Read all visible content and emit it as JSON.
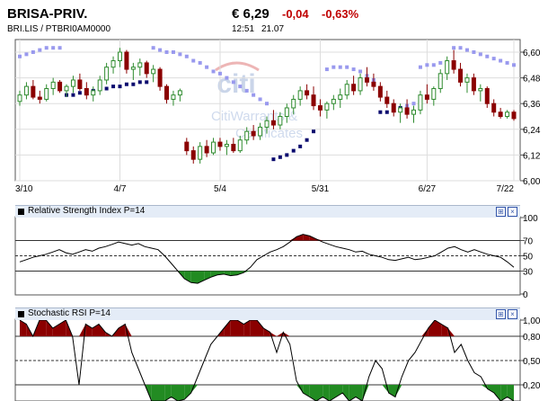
{
  "header": {
    "title": "BRISA-PRIV.",
    "subtitle": "BRI.LIS  /  PTBRI0AM0000",
    "price": "€ 6,29",
    "change": "-0,04",
    "change_pct": "-0,63%",
    "time": "12:51",
    "date": "21.07"
  },
  "watermark": {
    "logo": "citi",
    "line1": "CitiWarrants &",
    "line2": "Certificates"
  },
  "panels": {
    "rsi": {
      "label": "Relative Strength Index P=14",
      "ticks": [
        "100",
        "70",
        "50",
        "30",
        "0"
      ]
    },
    "stoch": {
      "label": "Stochastic RSI P=14",
      "ticks": [
        "1,00",
        "0,80",
        "0,50",
        "0,20"
      ]
    }
  },
  "chart_data": [
    {
      "type": "candlestick",
      "x_ticks": [
        "3/10",
        "4/7",
        "5/4",
        "5/31",
        "6/27",
        "7/22"
      ],
      "y_ticks": [
        "6,60",
        "6,48",
        "6,36",
        "6,24",
        "6,12",
        "6,00"
      ],
      "ylim": [
        6.0,
        6.6
      ],
      "colors": {
        "up": "#2e8b2e",
        "down": "#8b0000",
        "sar": "#9999ee",
        "sar_dark": "#0a0a6e"
      },
      "ohlc": [
        [
          6.37,
          6.42,
          6.35,
          6.4
        ],
        [
          6.4,
          6.46,
          6.38,
          6.44
        ],
        [
          6.44,
          6.47,
          6.38,
          6.39
        ],
        [
          6.39,
          6.42,
          6.36,
          6.38
        ],
        [
          6.38,
          6.45,
          6.37,
          6.43
        ],
        [
          6.43,
          6.48,
          6.4,
          6.46
        ],
        [
          6.46,
          6.47,
          6.41,
          6.42
        ],
        [
          6.42,
          6.45,
          6.39,
          6.44
        ],
        [
          6.44,
          6.49,
          6.41,
          6.47
        ],
        [
          6.47,
          6.5,
          6.42,
          6.43
        ],
        [
          6.43,
          6.46,
          6.38,
          6.4
        ],
        [
          6.4,
          6.44,
          6.37,
          6.42
        ],
        [
          6.42,
          6.49,
          6.4,
          6.47
        ],
        [
          6.47,
          6.55,
          6.45,
          6.53
        ],
        [
          6.53,
          6.58,
          6.5,
          6.56
        ],
        [
          6.56,
          6.62,
          6.53,
          6.6
        ],
        [
          6.6,
          6.61,
          6.5,
          6.52
        ],
        [
          6.52,
          6.55,
          6.47,
          6.53
        ],
        [
          6.53,
          6.57,
          6.49,
          6.55
        ],
        [
          6.55,
          6.56,
          6.48,
          6.5
        ],
        [
          6.5,
          6.54,
          6.46,
          6.52
        ],
        [
          6.52,
          6.53,
          6.42,
          6.44
        ],
        [
          6.44,
          6.45,
          6.36,
          6.38
        ],
        [
          6.38,
          6.42,
          6.35,
          6.4
        ],
        [
          6.4,
          6.43,
          6.37,
          6.42
        ],
        [
          6.18,
          6.2,
          6.12,
          6.14
        ],
        [
          6.14,
          6.16,
          6.08,
          6.1
        ],
        [
          6.1,
          6.18,
          6.08,
          6.16
        ],
        [
          6.16,
          6.19,
          6.11,
          6.13
        ],
        [
          6.13,
          6.2,
          6.12,
          6.18
        ],
        [
          6.18,
          6.2,
          6.14,
          6.16
        ],
        [
          6.16,
          6.19,
          6.12,
          6.17
        ],
        [
          6.17,
          6.2,
          6.13,
          6.14
        ],
        [
          6.14,
          6.21,
          6.13,
          6.19
        ],
        [
          6.19,
          6.25,
          6.17,
          6.23
        ],
        [
          6.23,
          6.26,
          6.19,
          6.21
        ],
        [
          6.21,
          6.27,
          6.19,
          6.25
        ],
        [
          6.25,
          6.3,
          6.22,
          6.28
        ],
        [
          6.28,
          6.33,
          6.24,
          6.26
        ],
        [
          6.26,
          6.32,
          6.24,
          6.3
        ],
        [
          6.3,
          6.36,
          6.27,
          6.34
        ],
        [
          6.34,
          6.4,
          6.31,
          6.38
        ],
        [
          6.38,
          6.44,
          6.35,
          6.42
        ],
        [
          6.42,
          6.45,
          6.38,
          6.4
        ],
        [
          6.4,
          6.44,
          6.33,
          6.35
        ],
        [
          6.35,
          6.38,
          6.3,
          6.33
        ],
        [
          6.33,
          6.37,
          6.29,
          6.36
        ],
        [
          6.36,
          6.4,
          6.33,
          6.38
        ],
        [
          6.38,
          6.43,
          6.34,
          6.4
        ],
        [
          6.4,
          6.47,
          6.38,
          6.45
        ],
        [
          6.45,
          6.49,
          6.4,
          6.42
        ],
        [
          6.42,
          6.5,
          6.4,
          6.48
        ],
        [
          6.48,
          6.53,
          6.44,
          6.46
        ],
        [
          6.46,
          6.5,
          6.42,
          6.44
        ],
        [
          6.44,
          6.46,
          6.37,
          6.39
        ],
        [
          6.39,
          6.42,
          6.34,
          6.36
        ],
        [
          6.36,
          6.38,
          6.3,
          6.32
        ],
        [
          6.32,
          6.36,
          6.27,
          6.34
        ],
        [
          6.34,
          6.38,
          6.29,
          6.31
        ],
        [
          6.31,
          6.35,
          6.27,
          6.33
        ],
        [
          6.33,
          6.42,
          6.31,
          6.4
        ],
        [
          6.4,
          6.45,
          6.36,
          6.38
        ],
        [
          6.38,
          6.44,
          6.35,
          6.43
        ],
        [
          6.43,
          6.52,
          6.41,
          6.5
        ],
        [
          6.5,
          6.58,
          6.47,
          6.56
        ],
        [
          6.56,
          6.61,
          6.5,
          6.52
        ],
        [
          6.52,
          6.55,
          6.44,
          6.46
        ],
        [
          6.46,
          6.5,
          6.41,
          6.48
        ],
        [
          6.48,
          6.5,
          6.4,
          6.42
        ],
        [
          6.42,
          6.45,
          6.37,
          6.43
        ],
        [
          6.43,
          6.44,
          6.34,
          6.36
        ],
        [
          6.36,
          6.38,
          6.3,
          6.32
        ],
        [
          6.32,
          6.34,
          6.29,
          6.3
        ],
        [
          6.3,
          6.33,
          6.29,
          6.32
        ],
        [
          6.32,
          6.33,
          6.28,
          6.29
        ]
      ],
      "sar": [
        [
          0,
          6.58
        ],
        [
          1,
          6.59
        ],
        [
          2,
          6.6
        ],
        [
          3,
          6.61
        ],
        [
          4,
          6.62
        ],
        [
          5,
          6.62
        ],
        [
          6,
          6.62
        ],
        [
          7,
          6.4
        ],
        [
          8,
          6.4
        ],
        [
          9,
          6.41
        ],
        [
          10,
          6.42
        ],
        [
          11,
          6.42
        ],
        [
          12,
          6.43
        ],
        [
          13,
          6.43
        ],
        [
          14,
          6.44
        ],
        [
          15,
          6.44
        ],
        [
          16,
          6.45
        ],
        [
          17,
          6.45
        ],
        [
          18,
          6.46
        ],
        [
          19,
          6.46
        ],
        [
          20,
          6.62
        ],
        [
          21,
          6.61
        ],
        [
          22,
          6.6
        ],
        [
          23,
          6.6
        ],
        [
          24,
          6.59
        ],
        [
          25,
          6.58
        ],
        [
          26,
          6.56
        ],
        [
          27,
          6.55
        ],
        [
          28,
          6.53
        ],
        [
          29,
          6.51
        ],
        [
          30,
          6.5
        ],
        [
          31,
          6.48
        ],
        [
          32,
          6.46
        ],
        [
          33,
          6.44
        ],
        [
          34,
          6.42
        ],
        [
          35,
          6.4
        ],
        [
          36,
          6.38
        ],
        [
          37,
          6.36
        ],
        [
          38,
          6.1
        ],
        [
          39,
          6.11
        ],
        [
          40,
          6.12
        ],
        [
          41,
          6.14
        ],
        [
          42,
          6.16
        ],
        [
          43,
          6.19
        ],
        [
          44,
          6.23
        ],
        [
          46,
          6.52
        ],
        [
          47,
          6.53
        ],
        [
          48,
          6.53
        ],
        [
          49,
          6.53
        ],
        [
          50,
          6.52
        ],
        [
          51,
          6.51
        ],
        [
          52,
          6.49
        ],
        [
          53,
          6.47
        ],
        [
          54,
          6.32
        ],
        [
          55,
          6.32
        ],
        [
          56,
          6.33
        ],
        [
          57,
          6.34
        ],
        [
          58,
          6.35
        ],
        [
          59,
          6.36
        ],
        [
          60,
          6.53
        ],
        [
          61,
          6.54
        ],
        [
          62,
          6.54
        ],
        [
          63,
          6.55
        ],
        [
          64,
          6.55
        ],
        [
          65,
          6.62
        ],
        [
          66,
          6.62
        ],
        [
          67,
          6.61
        ],
        [
          68,
          6.6
        ],
        [
          69,
          6.59
        ],
        [
          70,
          6.58
        ],
        [
          71,
          6.57
        ],
        [
          72,
          6.56
        ],
        [
          73,
          6.55
        ],
        [
          74,
          6.54
        ]
      ]
    },
    {
      "type": "line",
      "title": "Relative Strength Index P=14",
      "ylim": [
        0,
        100
      ],
      "levels": [
        70,
        50,
        30
      ],
      "values": [
        42,
        45,
        48,
        50,
        52,
        55,
        58,
        54,
        52,
        55,
        58,
        56,
        60,
        62,
        65,
        68,
        66,
        64,
        66,
        62,
        60,
        58,
        50,
        40,
        30,
        20,
        15,
        14,
        18,
        22,
        25,
        26,
        24,
        25,
        28,
        35,
        45,
        50,
        55,
        58,
        62,
        68,
        75,
        78,
        76,
        72,
        68,
        65,
        62,
        60,
        58,
        55,
        56,
        52,
        50,
        48,
        45,
        44,
        46,
        48,
        45,
        46,
        48,
        50,
        55,
        60,
        62,
        58,
        55,
        58,
        55,
        52,
        50,
        48,
        42,
        35
      ]
    },
    {
      "type": "line",
      "title": "Stochastic RSI P=14",
      "ylim": [
        0,
        1
      ],
      "levels": [
        0.8,
        0.5,
        0.2
      ],
      "values": [
        1.0,
        0.95,
        0.8,
        1.0,
        1.0,
        0.9,
        0.95,
        1.0,
        0.8,
        0.2,
        0.95,
        0.9,
        0.95,
        0.85,
        0.8,
        0.9,
        0.95,
        0.6,
        0.4,
        0.2,
        0.0,
        0.0,
        0.0,
        0.05,
        0.0,
        0.02,
        0.1,
        0.3,
        0.5,
        0.7,
        0.8,
        0.9,
        1.0,
        1.0,
        0.95,
        1.0,
        1.0,
        0.9,
        0.85,
        0.6,
        0.85,
        0.7,
        0.25,
        0.1,
        0.05,
        0.0,
        0.05,
        0.0,
        0.05,
        0.1,
        0.0,
        0.05,
        0.0,
        0.3,
        0.5,
        0.4,
        0.1,
        0.05,
        0.3,
        0.5,
        0.6,
        0.75,
        0.9,
        1.0,
        0.95,
        0.9,
        0.6,
        0.7,
        0.5,
        0.35,
        0.3,
        0.15,
        0.1,
        0.0,
        0.05,
        0.0
      ]
    }
  ]
}
